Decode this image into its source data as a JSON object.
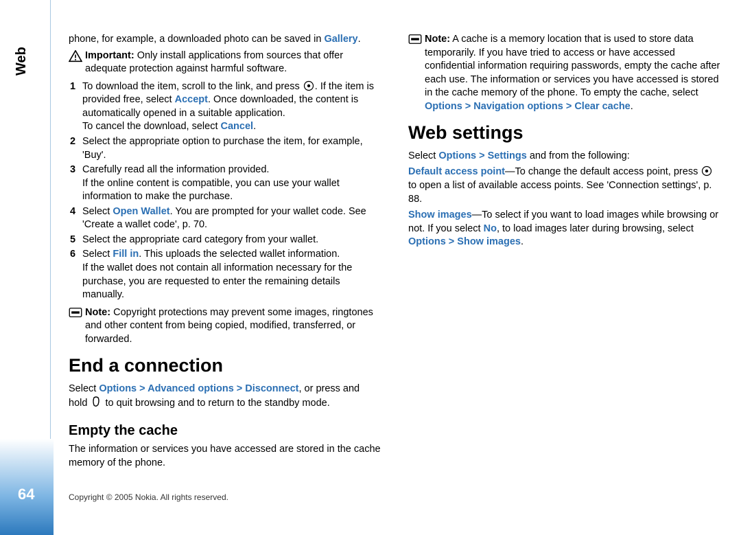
{
  "sidebar_tab": "Web",
  "page_number": "64",
  "copyright": "Copyright © 2005 Nokia. All rights reserved.",
  "intro_text_a": "phone, for example, a downloaded photo can be saved in ",
  "intro_link": "Gallery",
  "intro_text_b": ".",
  "important_label": "Important:",
  "important_text": " Only install applications from sources that offer adequate protection against harmful software.",
  "step1_a": "To download the item, scroll to the link, and press ",
  "step1_b": ". If the item is provided free, select ",
  "step1_accept": "Accept",
  "step1_c": ". Once downloaded, the content is automatically opened in a suitable application.",
  "step1_cancel_a": "To cancel the download, select ",
  "step1_cancel": "Cancel",
  "step1_cancel_b": ".",
  "step2": "Select the appropriate option to purchase the item, for example, 'Buy'.",
  "step3_a": "Carefully read all the information provided.",
  "step3_b": "If the online content is compatible, you can use your wallet information to make the purchase.",
  "step4_a": "Select ",
  "step4_link": "Open Wallet",
  "step4_b": ". You are prompted for your wallet code. See 'Create a wallet code', p. 70.",
  "step5": "Select the appropriate card category from your wallet.",
  "step6_a": "Select ",
  "step6_link": "Fill in",
  "step6_b": ". This uploads the selected wallet information.",
  "step6_c": "If the wallet does not contain all information necessary for the purchase, you are requested to enter the remaining details manually.",
  "note1_label": "Note:",
  "note1_text": " Copyright protections may prevent some images, ringtones and other content from being copied, modified, transferred, or forwarded.",
  "h1_end": "End a connection",
  "end_a": "Select ",
  "end_path": "Options > Advanced options > Disconnect",
  "end_b": ", or press and hold ",
  "end_c": " to quit browsing and to return to the standby mode.",
  "h2_empty": "Empty the cache",
  "empty_p": "The information or services you have accessed are stored in the cache memory of the phone.",
  "note2_label": "Note:",
  "note2_a": " A cache is a memory location that is used to store data temporarily. If you have tried to access or have accessed confidential information requiring passwords, empty the cache after each use. The information or services you have accessed is stored in the cache memory of the phone. To empty the cache, select ",
  "note2_path": "Options > Navigation options > Clear cache",
  "note2_b": ".",
  "h1_settings": "Web settings",
  "ws_a": "Select ",
  "ws_path": "Options > Settings",
  "ws_b": " and from the following:",
  "dap_label": "Default access point",
  "dap_a": "—To change the default access point, press ",
  "dap_b": " to open a list of available access points. See 'Connection settings', p. 88.",
  "si_label": "Show images",
  "si_a": "—To select if you want to load images while browsing or not. If you select ",
  "si_no": "No",
  "si_b": ", to load images later during browsing, select ",
  "si_path": "Options > Show images",
  "si_c": "."
}
